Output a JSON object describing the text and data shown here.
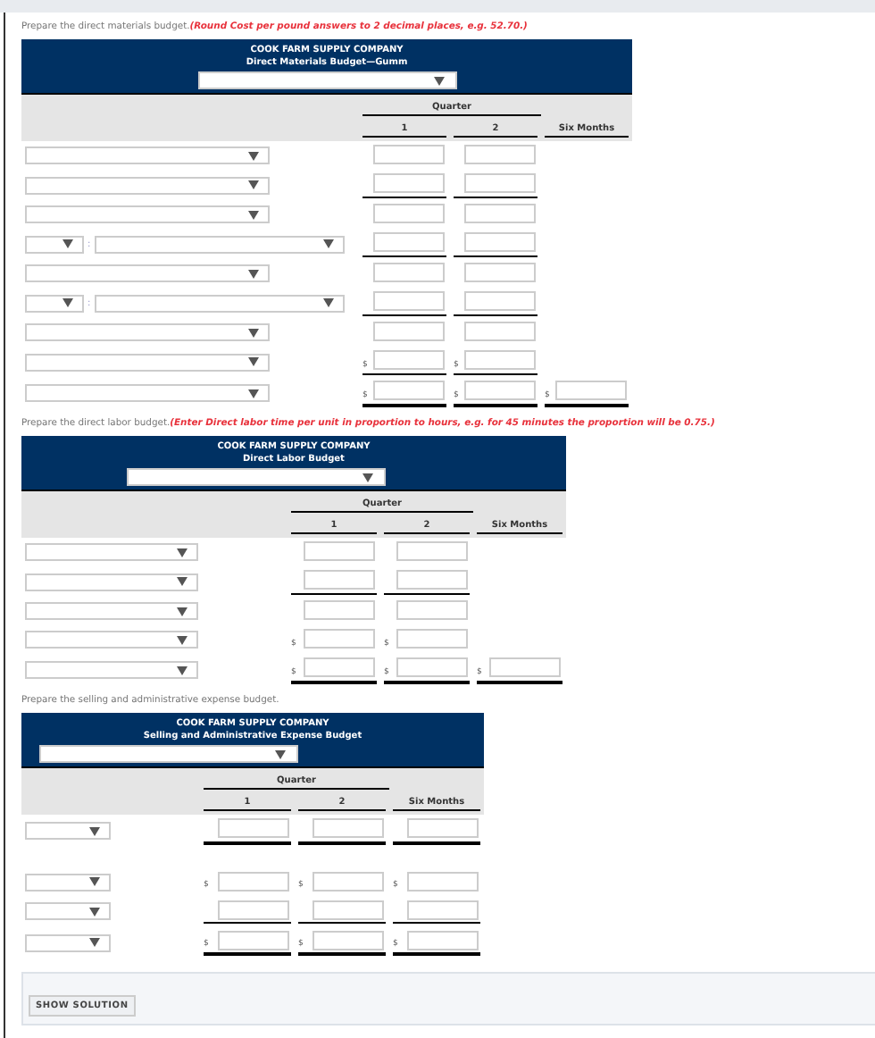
{
  "budgets": [
    {
      "intro": "Prepare the direct materials budget.",
      "note": "(Round Cost per pound answers to 2 decimal places, e.g. 52.70.)",
      "company": "COOK FARM SUPPLY COMPANY",
      "title": "Direct Materials Budget—Gumm",
      "quarter": "Quarter",
      "columns": [
        "1",
        "2",
        "Six Months"
      ],
      "rows": [
        {
          "kind": "select",
          "cells": [
            {
              "kind": "input"
            },
            {
              "kind": "input"
            },
            {
              "kind": "blank"
            }
          ]
        },
        {
          "kind": "select",
          "cells": [
            {
              "kind": "subtotal"
            },
            {
              "kind": "subtotal"
            },
            {
              "kind": "blank"
            }
          ]
        },
        {
          "kind": "select",
          "cells": [
            {
              "kind": "input"
            },
            {
              "kind": "input"
            },
            {
              "kind": "blank"
            }
          ]
        },
        {
          "kind": "split",
          "separator": ":",
          "cells": [
            {
              "kind": "subtotal"
            },
            {
              "kind": "subtotal"
            },
            {
              "kind": "blank"
            }
          ]
        },
        {
          "kind": "select",
          "cells": [
            {
              "kind": "input"
            },
            {
              "kind": "input"
            },
            {
              "kind": "blank"
            }
          ]
        },
        {
          "kind": "split",
          "separator": ":",
          "cells": [
            {
              "kind": "subtotal"
            },
            {
              "kind": "subtotal"
            },
            {
              "kind": "blank"
            }
          ]
        },
        {
          "kind": "select",
          "cells": [
            {
              "kind": "input"
            },
            {
              "kind": "input"
            },
            {
              "kind": "blank"
            }
          ]
        },
        {
          "kind": "select",
          "cells": [
            {
              "kind": "subtotal",
              "prefix": "$"
            },
            {
              "kind": "subtotal",
              "prefix": "$"
            },
            {
              "kind": "blank"
            }
          ]
        },
        {
          "kind": "select",
          "cells": [
            {
              "kind": "total",
              "prefix": "$"
            },
            {
              "kind": "total",
              "prefix": "$"
            },
            {
              "kind": "total",
              "prefix": "$"
            }
          ]
        }
      ]
    },
    {
      "intro": "Prepare the direct labor budget.",
      "note": "(Enter Direct labor time per unit in proportion to hours, e.g. for 45 minutes the proportion will be 0.75.)",
      "company": "COOK FARM SUPPLY COMPANY",
      "title": "Direct Labor Budget",
      "quarter": "Quarter",
      "columns": [
        "1",
        "2",
        "Six Months"
      ],
      "rows": [
        {
          "kind": "select",
          "cells": [
            {
              "kind": "input"
            },
            {
              "kind": "input"
            },
            {
              "kind": "blank"
            }
          ]
        },
        {
          "kind": "select",
          "cells": [
            {
              "kind": "subtotal"
            },
            {
              "kind": "subtotal"
            },
            {
              "kind": "blank"
            }
          ]
        },
        {
          "kind": "select",
          "cells": [
            {
              "kind": "input"
            },
            {
              "kind": "input"
            },
            {
              "kind": "blank"
            }
          ]
        },
        {
          "kind": "select",
          "cells": [
            {
              "kind": "input",
              "prefix": "$"
            },
            {
              "kind": "input",
              "prefix": "$"
            },
            {
              "kind": "blank"
            }
          ]
        },
        {
          "kind": "select",
          "cells": [
            {
              "kind": "total",
              "prefix": "$"
            },
            {
              "kind": "total",
              "prefix": "$"
            },
            {
              "kind": "total",
              "prefix": "$"
            }
          ]
        }
      ]
    },
    {
      "intro": "Prepare the selling and administrative expense budget.",
      "company": "COOK FARM SUPPLY COMPANY",
      "title": "Selling and Administrative Expense Budget",
      "quarter": "Quarter",
      "columns": [
        "1",
        "2",
        "Six Months"
      ],
      "rows": [
        {
          "kind": "select",
          "cells": [
            {
              "kind": "total"
            },
            {
              "kind": "total"
            },
            {
              "kind": "total"
            }
          ]
        },
        {
          "kind": "select",
          "spaced": true,
          "cells": [
            {
              "kind": "input",
              "prefix": "$"
            },
            {
              "kind": "input",
              "prefix": "$"
            },
            {
              "kind": "input",
              "prefix": "$"
            }
          ]
        },
        {
          "kind": "select",
          "cells": [
            {
              "kind": "subtotal"
            },
            {
              "kind": "subtotal"
            },
            {
              "kind": "subtotal"
            }
          ]
        },
        {
          "kind": "select",
          "cells": [
            {
              "kind": "total",
              "prefix": "$"
            },
            {
              "kind": "total",
              "prefix": "$"
            },
            {
              "kind": "total",
              "prefix": "$"
            }
          ]
        }
      ]
    }
  ],
  "solution_button": "SHOW SOLUTION"
}
